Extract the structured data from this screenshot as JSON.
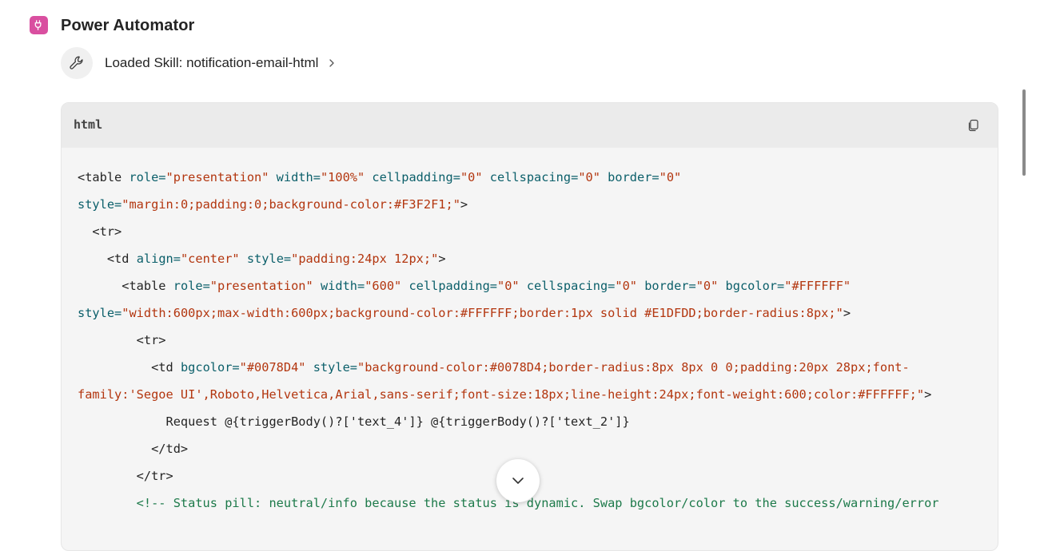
{
  "app": {
    "title": "Power Automator",
    "icon": "plug-icon",
    "accent": "#d94fa0"
  },
  "skill": {
    "label": "Loaded Skill: notification-email-html",
    "icon": "wrench-icon"
  },
  "code": {
    "language": "html",
    "copy_icon": "copy-icon",
    "lines": [
      [
        [
          "t",
          "<table "
        ],
        [
          "a",
          "role="
        ],
        [
          "s",
          "\"presentation\""
        ],
        [
          "a",
          " width="
        ],
        [
          "s",
          "\"100%\""
        ],
        [
          "a",
          " cellpadding="
        ],
        [
          "s",
          "\"0\""
        ],
        [
          "a",
          " cellspacing="
        ],
        [
          "s",
          "\"0\""
        ],
        [
          "a",
          " border="
        ],
        [
          "s",
          "\"0\""
        ]
      ],
      [
        [
          "a",
          "style="
        ],
        [
          "s",
          "\"margin:0;padding:0;background-color:#F3F2F1;\""
        ],
        [
          "t",
          ">"
        ]
      ],
      [
        [
          "t",
          "  <tr>"
        ]
      ],
      [
        [
          "t",
          "    <td "
        ],
        [
          "a",
          "align="
        ],
        [
          "s",
          "\"center\""
        ],
        [
          "a",
          " style="
        ],
        [
          "s",
          "\"padding:24px 12px;\""
        ],
        [
          "t",
          ">"
        ]
      ],
      [
        [
          "t",
          "      <table "
        ],
        [
          "a",
          "role="
        ],
        [
          "s",
          "\"presentation\""
        ],
        [
          "a",
          " width="
        ],
        [
          "s",
          "\"600\""
        ],
        [
          "a",
          " cellpadding="
        ],
        [
          "s",
          "\"0\""
        ],
        [
          "a",
          " cellspacing="
        ],
        [
          "s",
          "\"0\""
        ],
        [
          "a",
          " border="
        ],
        [
          "s",
          "\"0\""
        ],
        [
          "a",
          " bgcolor="
        ],
        [
          "s",
          "\"#FFFFFF\""
        ]
      ],
      [
        [
          "a",
          "style="
        ],
        [
          "s",
          "\"width:600px;max-width:600px;background-color:#FFFFFF;border:1px solid #E1DFDD;border-radius:8px;\""
        ],
        [
          "t",
          ">"
        ]
      ],
      [
        [
          "t",
          "        <tr>"
        ]
      ],
      [
        [
          "t",
          "          <td "
        ],
        [
          "a",
          "bgcolor="
        ],
        [
          "s",
          "\"#0078D4\""
        ],
        [
          "a",
          " style="
        ],
        [
          "s",
          "\"background-color:#0078D4;border-radius:8px 8px 0 0;padding:20px 28px;font-"
        ]
      ],
      [
        [
          "s",
          "family:'Segoe UI',Roboto,Helvetica,Arial,sans-serif;font-size:18px;line-height:24px;font-weight:600;color:#FFFFFF;\""
        ],
        [
          "t",
          ">"
        ]
      ],
      [
        [
          "t",
          "            Request @{triggerBody()?['text_4']} @{triggerBody()?['text_2']}"
        ]
      ],
      [
        [
          "t",
          "          </td>"
        ]
      ],
      [
        [
          "t",
          "        </tr>"
        ]
      ],
      [
        [
          "c",
          "        <!-- Status pill: neutral/info because the status is dynamic. Swap bgcolor/color to the success/warning/error"
        ]
      ]
    ]
  },
  "scroll_down_icon": "chevron-down-icon"
}
